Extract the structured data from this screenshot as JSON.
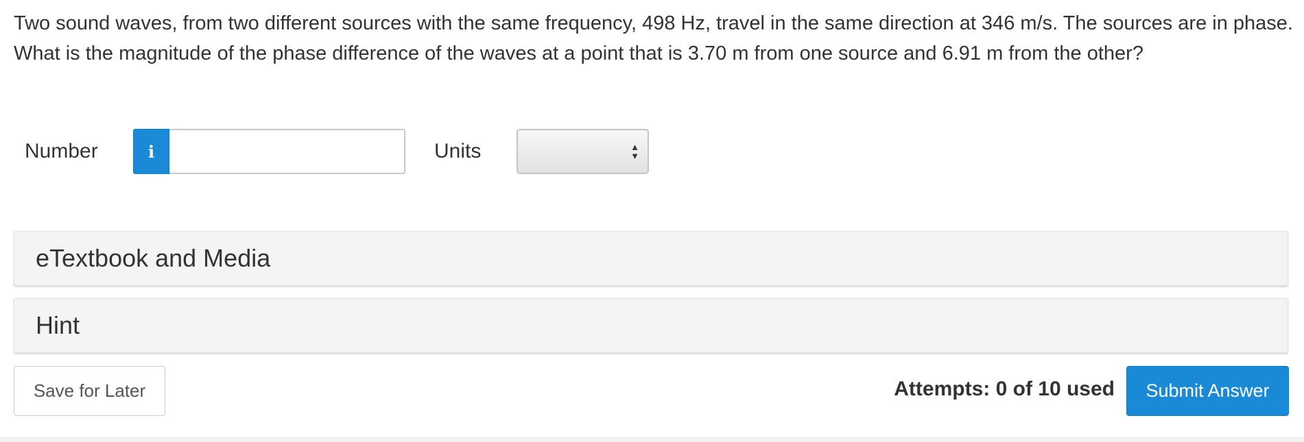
{
  "question": {
    "text": "Two sound waves, from two different sources with the same frequency, 498 Hz, travel in the same direction at 346 m/s. The sources are in phase. What is the magnitude of the phase difference of the waves at a point that is 3.70 m from one source and 6.91 m from the other?"
  },
  "answer": {
    "number_label": "Number",
    "info_icon": "info-icon",
    "info_glyph": "i",
    "number_value": "",
    "units_label": "Units",
    "units_selected": ""
  },
  "panels": {
    "etextbook_label": "eTextbook and Media",
    "hint_label": "Hint"
  },
  "footer": {
    "save_label": "Save for Later",
    "attempts_text": "Attempts: 0 of 10 used",
    "submit_label": "Submit Answer"
  },
  "colors": {
    "accent": "#1a8ad6",
    "panel_bg": "#f4f4f4",
    "text": "#333333"
  }
}
